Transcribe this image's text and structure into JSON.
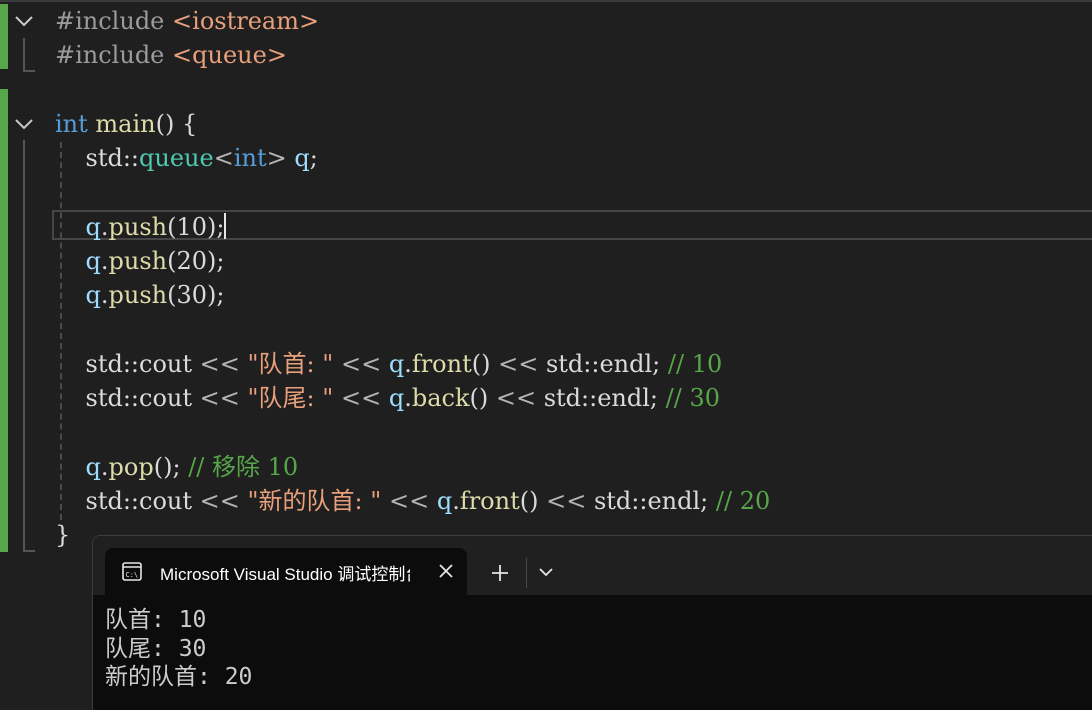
{
  "editor": {
    "line1": {
      "directive": "#include",
      "header": "<iostream>"
    },
    "line2": {
      "directive": "#include",
      "header": "<queue>"
    },
    "line4": {
      "keyword": "int",
      "func": "main",
      "parens": "()",
      "brace": "{"
    },
    "line5": {
      "ns": "std::",
      "type": "queue",
      "lt": "<",
      "targ": "int",
      "gt": ">",
      "var": "q",
      "semi": ";"
    },
    "line7": {
      "var": "q",
      "dot": ".",
      "method": "push",
      "args": "(10)",
      "semi": ";"
    },
    "line8": {
      "var": "q",
      "dot": ".",
      "method": "push",
      "args": "(20)",
      "semi": ";"
    },
    "line9": {
      "var": "q",
      "dot": ".",
      "method": "push",
      "args": "(30)",
      "semi": ";"
    },
    "line11": {
      "cout": "std::cout",
      "op1": "<<",
      "str": "\"队首: \"",
      "op2": "<<",
      "var": "q",
      "dot": ".",
      "method": "front",
      "call": "()",
      "op3": "<<",
      "endl": "std::endl",
      "semi": ";",
      "comment": "// 10"
    },
    "line12": {
      "cout": "std::cout",
      "op1": "<<",
      "str": "\"队尾: \"",
      "op2": "<<",
      "var": "q",
      "dot": ".",
      "method": "back",
      "call": "()",
      "op3": "<<",
      "endl": "std::endl",
      "semi": ";",
      "comment": "// 30"
    },
    "line14": {
      "var": "q",
      "dot": ".",
      "method": "pop",
      "call": "()",
      "semi": ";",
      "comment": "// 移除 10"
    },
    "line15": {
      "cout": "std::cout",
      "op1": "<<",
      "str": "\"新的队首: \"",
      "op2": "<<",
      "var": "q",
      "dot": ".",
      "method": "front",
      "call": "()",
      "op3": "<<",
      "endl": "std::endl",
      "semi": ";",
      "comment": "// 20"
    },
    "line16": {
      "brace": "}"
    }
  },
  "terminal": {
    "tab_title": "Microsoft Visual Studio 调试控制台",
    "output": [
      "队首: 10",
      "队尾: 30",
      "新的队首: 20"
    ]
  },
  "colors": {
    "background": "#1f1f1f",
    "keyword": "#569cd6",
    "type": "#4ec9b0",
    "function": "#dcdcaa",
    "variable": "#9cdcfe",
    "string": "#e8a07c",
    "comment": "#57a64a",
    "preprocessor": "#9b9b9b",
    "terminal_background": "#0c0c0c"
  },
  "icons": [
    "collapse-chevron-icon",
    "terminal-app-icon",
    "close-icon",
    "plus-icon",
    "chevron-down-icon"
  ]
}
